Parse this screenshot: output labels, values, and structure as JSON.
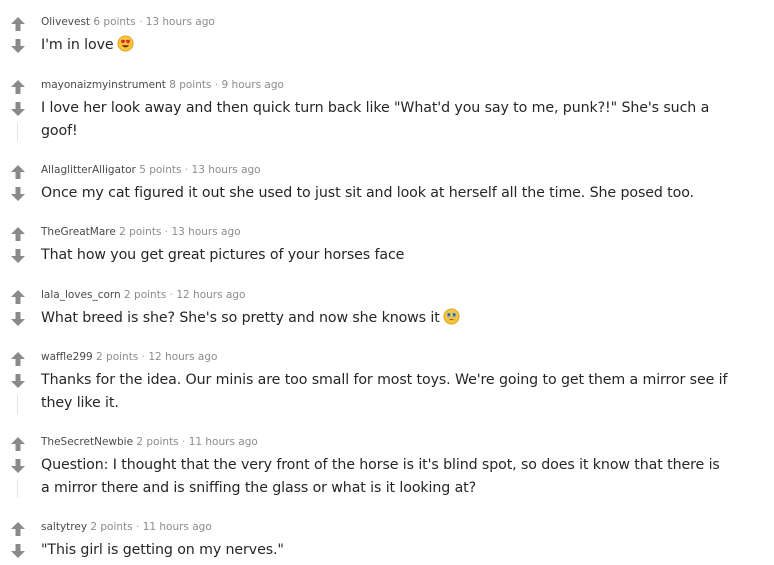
{
  "comments": [
    {
      "author": "Olivevest",
      "points": "6 points",
      "separator": "·",
      "time": "13 hours ago",
      "text": "I'm in love",
      "emoji": "heart-eyes-emoji"
    },
    {
      "author": "mayonaizmyinstrument",
      "points": "8 points",
      "separator": "·",
      "time": "9 hours ago",
      "text": "I love her look away and then quick turn back like \"What'd you say to me, punk?!\" She's such a goof!"
    },
    {
      "author": "AllaglitterAlligator",
      "points": "5 points",
      "separator": "·",
      "time": "13 hours ago",
      "text": "Once my cat figured it out she used to just sit and look at herself all the time. She posed too."
    },
    {
      "author": "TheGreatMare",
      "points": "2 points",
      "separator": "·",
      "time": "13 hours ago",
      "text": "That how you get great pictures of your horses face"
    },
    {
      "author": "lala_loves_corn",
      "points": "2 points",
      "separator": "·",
      "time": "12 hours ago",
      "text": "What breed is she? She's so pretty and now she knows it",
      "emoji": "crying-face-emoji"
    },
    {
      "author": "waffle299",
      "points": "2 points",
      "separator": "·",
      "time": "12 hours ago",
      "text": "Thanks for the idea. Our minis are too small for most toys. We're going to get them a mirror see if they like it."
    },
    {
      "author": "TheSecretNewbie",
      "points": "2 points",
      "separator": "·",
      "time": "11 hours ago",
      "text": "Question: I thought that the very front of the horse is it's blind spot, so does it know that there is a mirror there and is sniffing the glass or what is it looking at?"
    },
    {
      "author": "saltytrey",
      "points": "2 points",
      "separator": "·",
      "time": "11 hours ago",
      "text": "\"This girl is getting on my nerves.\""
    }
  ],
  "colors": {
    "vote_arrow": "#8a8a8a",
    "author": "#4a4a4a",
    "meta": "#8c8c8c",
    "body_text": "#262626",
    "thread_line": "#e2e2e2"
  }
}
